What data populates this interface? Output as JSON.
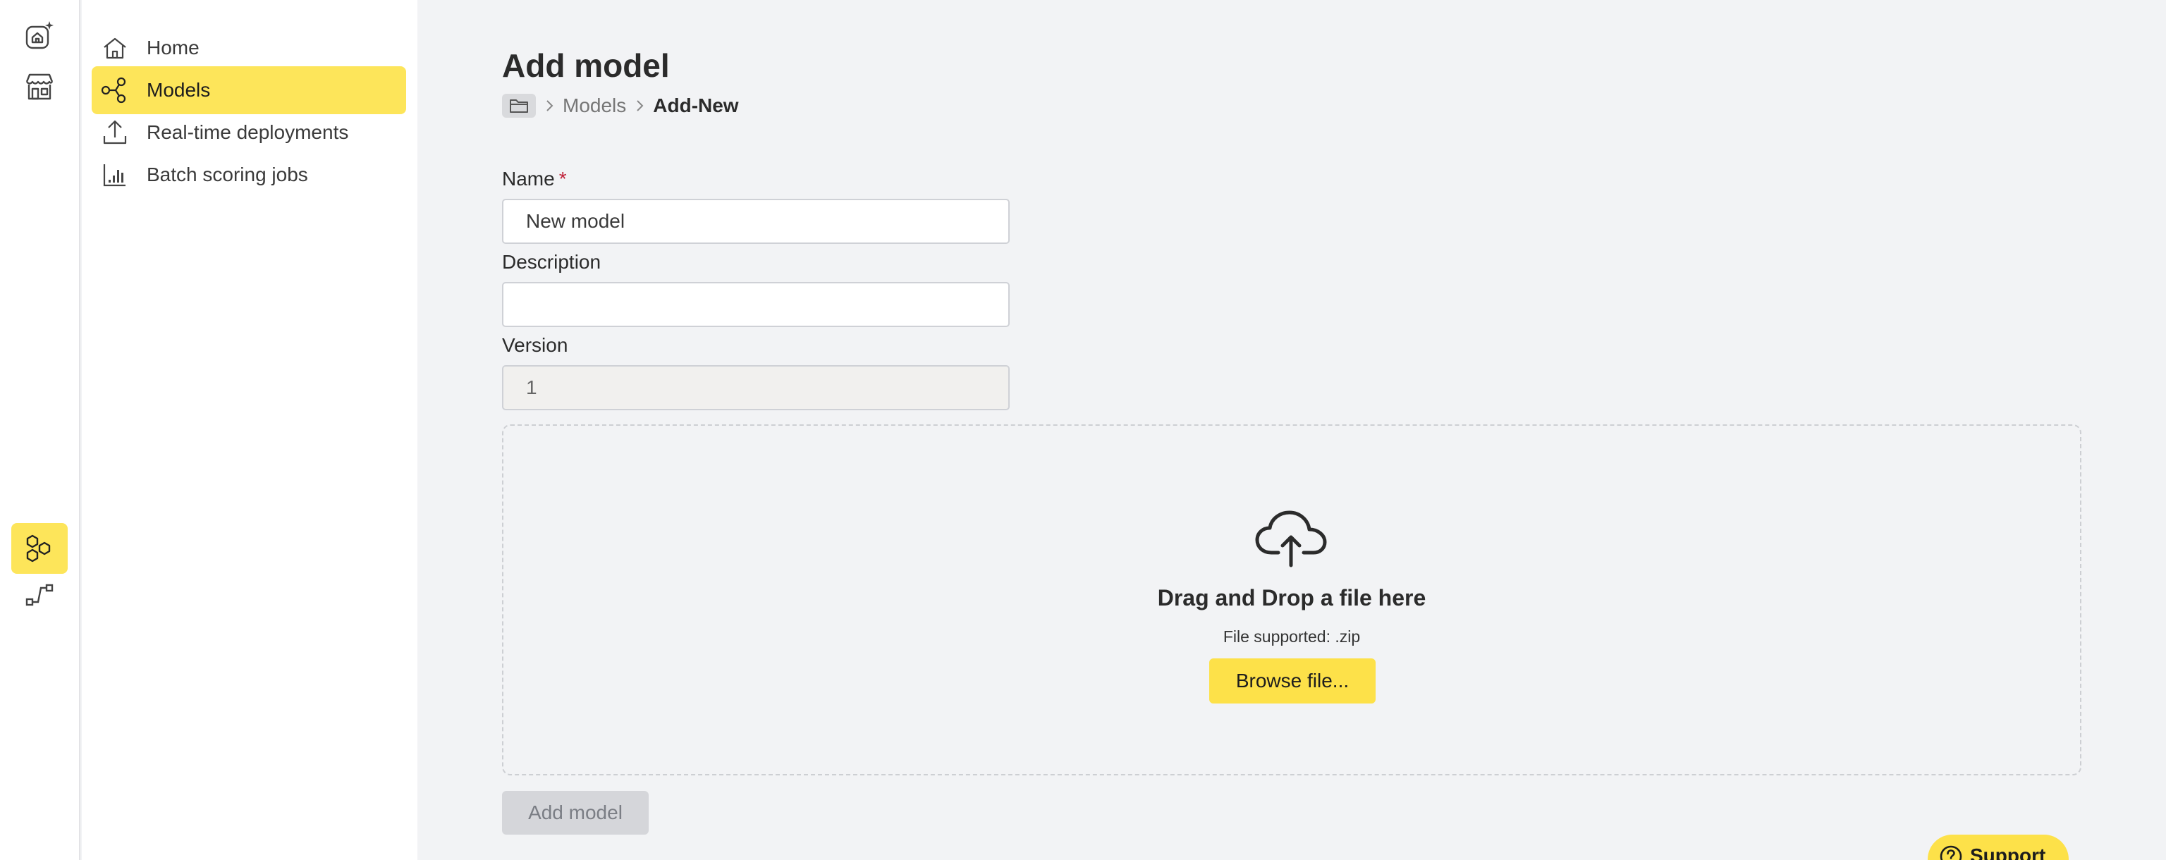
{
  "rail": {
    "items": [
      {
        "icon": "home-sparkle-icon",
        "active": false
      },
      {
        "icon": "store-icon",
        "active": false
      },
      {
        "icon": "models-hub-icon",
        "active": true
      },
      {
        "icon": "pipeline-icon",
        "active": false
      }
    ]
  },
  "subnav": {
    "items": [
      {
        "label": "Home",
        "icon": "home-icon",
        "active": false
      },
      {
        "label": "Models",
        "icon": "model-graph-icon",
        "active": true
      },
      {
        "label": "Real-time deployments",
        "icon": "upload-icon",
        "active": false
      },
      {
        "label": "Batch scoring jobs",
        "icon": "bar-chart-icon",
        "active": false
      }
    ]
  },
  "page": {
    "title": "Add model",
    "breadcrumb": {
      "folder_icon": "folder-icon",
      "items": [
        "Models",
        "Add-New"
      ]
    }
  },
  "form": {
    "name_label": "Name",
    "name_required": "*",
    "name_value": "New model",
    "description_label": "Description",
    "description_value": "",
    "version_label": "Version",
    "version_value": "1"
  },
  "dropzone": {
    "icon": "cloud-upload-icon",
    "title": "Drag and Drop a file here",
    "subtitle": "File supported: .zip",
    "browse_label": "Browse file..."
  },
  "actions": {
    "add_label": "Add model"
  },
  "support": {
    "icon": "help-circle-icon",
    "label": "Support"
  },
  "colors": {
    "accent": "#fde55a",
    "background": "#f2f3f5",
    "required": "#c0233a",
    "disabled_button": "#d5d6da"
  }
}
